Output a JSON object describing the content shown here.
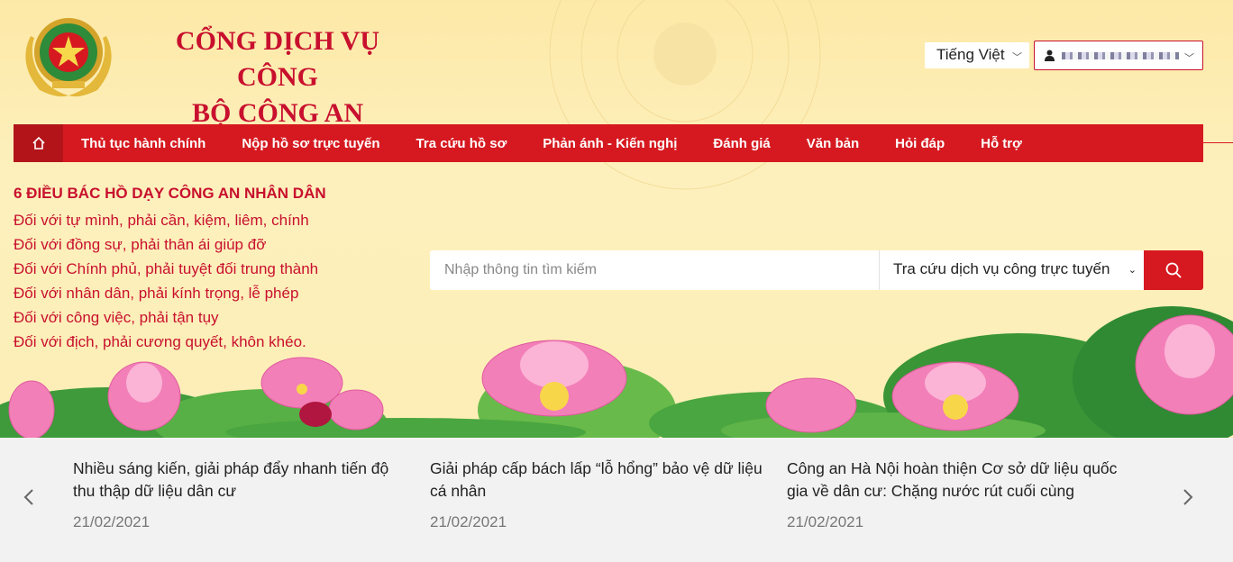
{
  "header": {
    "site_title_line1": "CỔNG DỊCH VỤ CÔNG",
    "site_title_line2": "BỘ CÔNG AN",
    "language": "Tiếng Việt",
    "user_icon": "user-icon",
    "user_name": ""
  },
  "nav": {
    "home_icon": "home-icon",
    "items": [
      {
        "label": "Thủ tục hành chính"
      },
      {
        "label": "Nộp hồ sơ trực tuyến"
      },
      {
        "label": "Tra cứu hồ sơ"
      },
      {
        "label": "Phản ánh - Kiến nghị"
      },
      {
        "label": "Đánh giá"
      },
      {
        "label": "Văn bản"
      },
      {
        "label": "Hỏi đáp"
      },
      {
        "label": "Hỗ trợ"
      }
    ]
  },
  "teachings": {
    "heading": "6 ĐIỀU BÁC HỒ DẠY CÔNG AN NHÂN DÂN",
    "lines": [
      "Đối với tự mình, phải cần, kiệm, liêm, chính",
      "Đối với đồng sự, phải thân ái giúp đỡ",
      "Đối với Chính phủ, phải tuyệt đối trung thành",
      "Đối với nhân dân, phải kính trọng, lễ phép",
      "Đối với công việc, phải tận tụy",
      "Đối với địch, phải cương quyết, khôn khéo."
    ]
  },
  "search": {
    "placeholder": "Nhập thông tin tìm kiếm",
    "scope": "Tra cứu dịch vụ công trực tuyến",
    "button_icon": "search-icon"
  },
  "news": {
    "items": [
      {
        "title": "Nhiều sáng kiến, giải pháp đẩy nhanh tiến độ thu thập dữ liệu dân cư",
        "date": "21/02/2021"
      },
      {
        "title": "Giải pháp cấp bách lấp “lỗ hổng” bảo vệ dữ liệu cá nhân",
        "date": "21/02/2021"
      },
      {
        "title": "Công an Hà Nội hoàn thiện Cơ sở dữ liệu quốc gia về dân cư: Chặng nước rút cuối cùng",
        "date": "21/02/2021"
      }
    ]
  },
  "colors": {
    "brand_red": "#d61920",
    "title_red": "#c8102e",
    "background_yellow": "#fdefb1"
  }
}
